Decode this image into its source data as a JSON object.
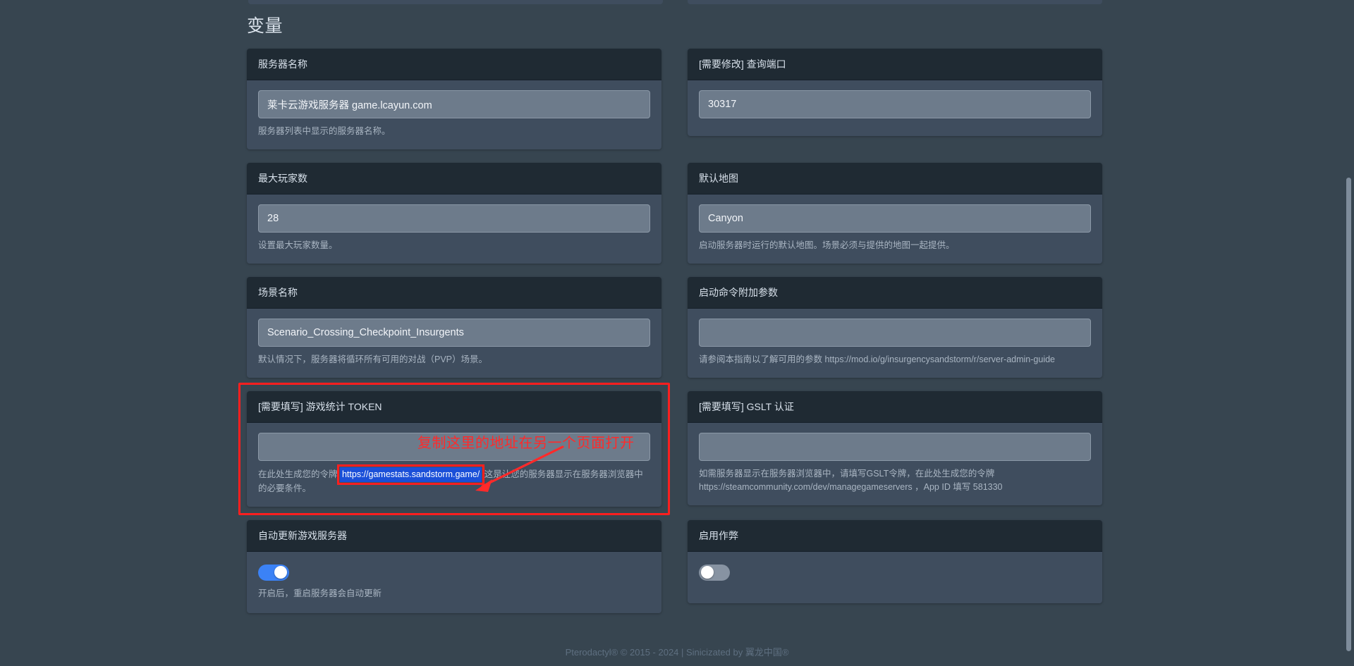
{
  "page": {
    "title": "变量",
    "footer": "Pterodactyl® © 2015 - 2024 | Sinicizated by 翼龙中国®"
  },
  "colors": {
    "page_background": "#374550",
    "card_body": "#3f4d5e",
    "card_header": "#1f2a33",
    "input_background": "#6d7b8b",
    "accent_toggle_on": "#3b82f6",
    "toggle_off": "#8793a2",
    "annotation_red": "#ff1f1f",
    "selection_blue": "#1a4fd8",
    "text_primary": "#d7e0ea",
    "text_muted": "#a9b5c2"
  },
  "variables": [
    {
      "id": "server-name",
      "label": "服务器名称",
      "value": "莱卡云游戏服务器 game.lcayun.com",
      "description": "服务器列表中显示的服务器名称。",
      "type": "text"
    },
    {
      "id": "query-port",
      "label": "[需要修改] 查询端口",
      "value": "30317",
      "description": "",
      "type": "text"
    },
    {
      "id": "max-players",
      "label": "最大玩家数",
      "value": "28",
      "description": "设置最大玩家数量。",
      "type": "text"
    },
    {
      "id": "default-map",
      "label": "默认地图",
      "value": "Canyon",
      "description": "启动服务器时运行的默认地图。场景必须与提供的地图一起提供。",
      "type": "text"
    },
    {
      "id": "scenario-name",
      "label": "场景名称",
      "value": "Scenario_Crossing_Checkpoint_Insurgents",
      "description": "默认情况下，服务器将循环所有可用的对战（PVP）场景。",
      "type": "text"
    },
    {
      "id": "extra-launch-args",
      "label": "启动命令附加参数",
      "value": "",
      "description": "请参阅本指南以了解可用的参数 https://mod.io/g/insurgencysandstorm/r/server-admin-guide",
      "type": "text"
    },
    {
      "id": "gamestats-token",
      "label": "[需要填写] 游戏统计 TOKEN",
      "value": "",
      "description_before": "在此处生成您的令牌 ",
      "description_url": "https://gamestats.sandstorm.game/",
      "description_after": " 这是让您的服务器显示在服务器浏览器中的必要条件。",
      "type": "text",
      "highlighted": true
    },
    {
      "id": "gslt-auth",
      "label": "[需要填写] GSLT 认证",
      "value": "",
      "description": "如需服务器显示在服务器浏览器中，请填写GSLT令牌，在此处生成您的令牌 https://steamcommunity.com/dev/managegameservers ，App ID 填写 581330",
      "type": "text"
    },
    {
      "id": "auto-update",
      "label": "自动更新游戏服务器",
      "toggle_state": "on",
      "description": "开启后，重启服务器会自动更新",
      "type": "toggle"
    },
    {
      "id": "enable-cheats",
      "label": "启用作弊",
      "toggle_state": "off",
      "description": "",
      "type": "toggle"
    }
  ],
  "annotation": {
    "text": "复制这里的地址在另一个页面打开",
    "arrow": "red-arrow-pointing-down-left"
  }
}
